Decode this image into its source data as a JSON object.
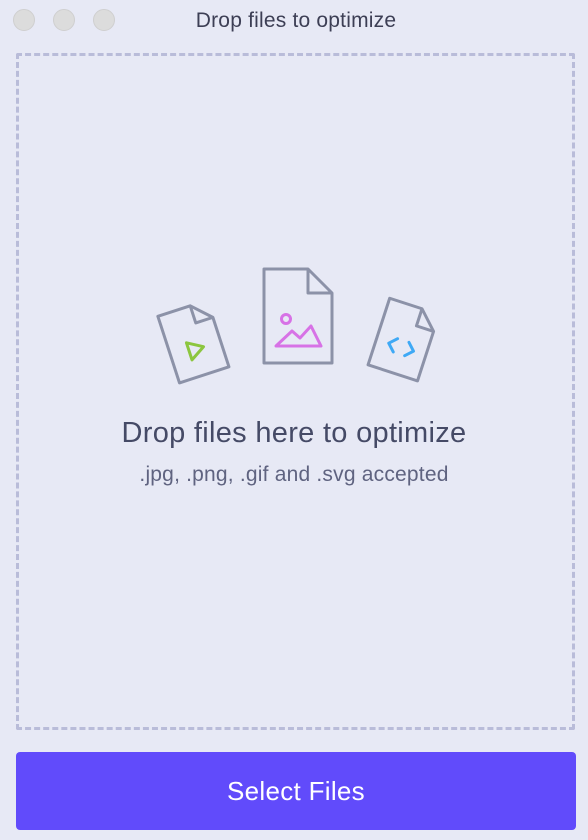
{
  "window": {
    "title": "Drop files to optimize",
    "controls": [
      "close",
      "minimize",
      "zoom"
    ]
  },
  "dropzone": {
    "headline": "Drop files here to optimize",
    "accepted": ".jpg, .png, .gif and .svg accepted",
    "icons": [
      "video-file-icon",
      "image-file-icon",
      "code-file-icon"
    ]
  },
  "actions": {
    "select_label": "Select Files"
  },
  "colors": {
    "background": "#e7e9f5",
    "dashed_border": "#b9bcd9",
    "button": "#614bfb",
    "file_outline": "#8c92a8",
    "play_icon": "#8cc63f",
    "image_icon": "#d772e6",
    "code_icon": "#3fa9f5"
  }
}
